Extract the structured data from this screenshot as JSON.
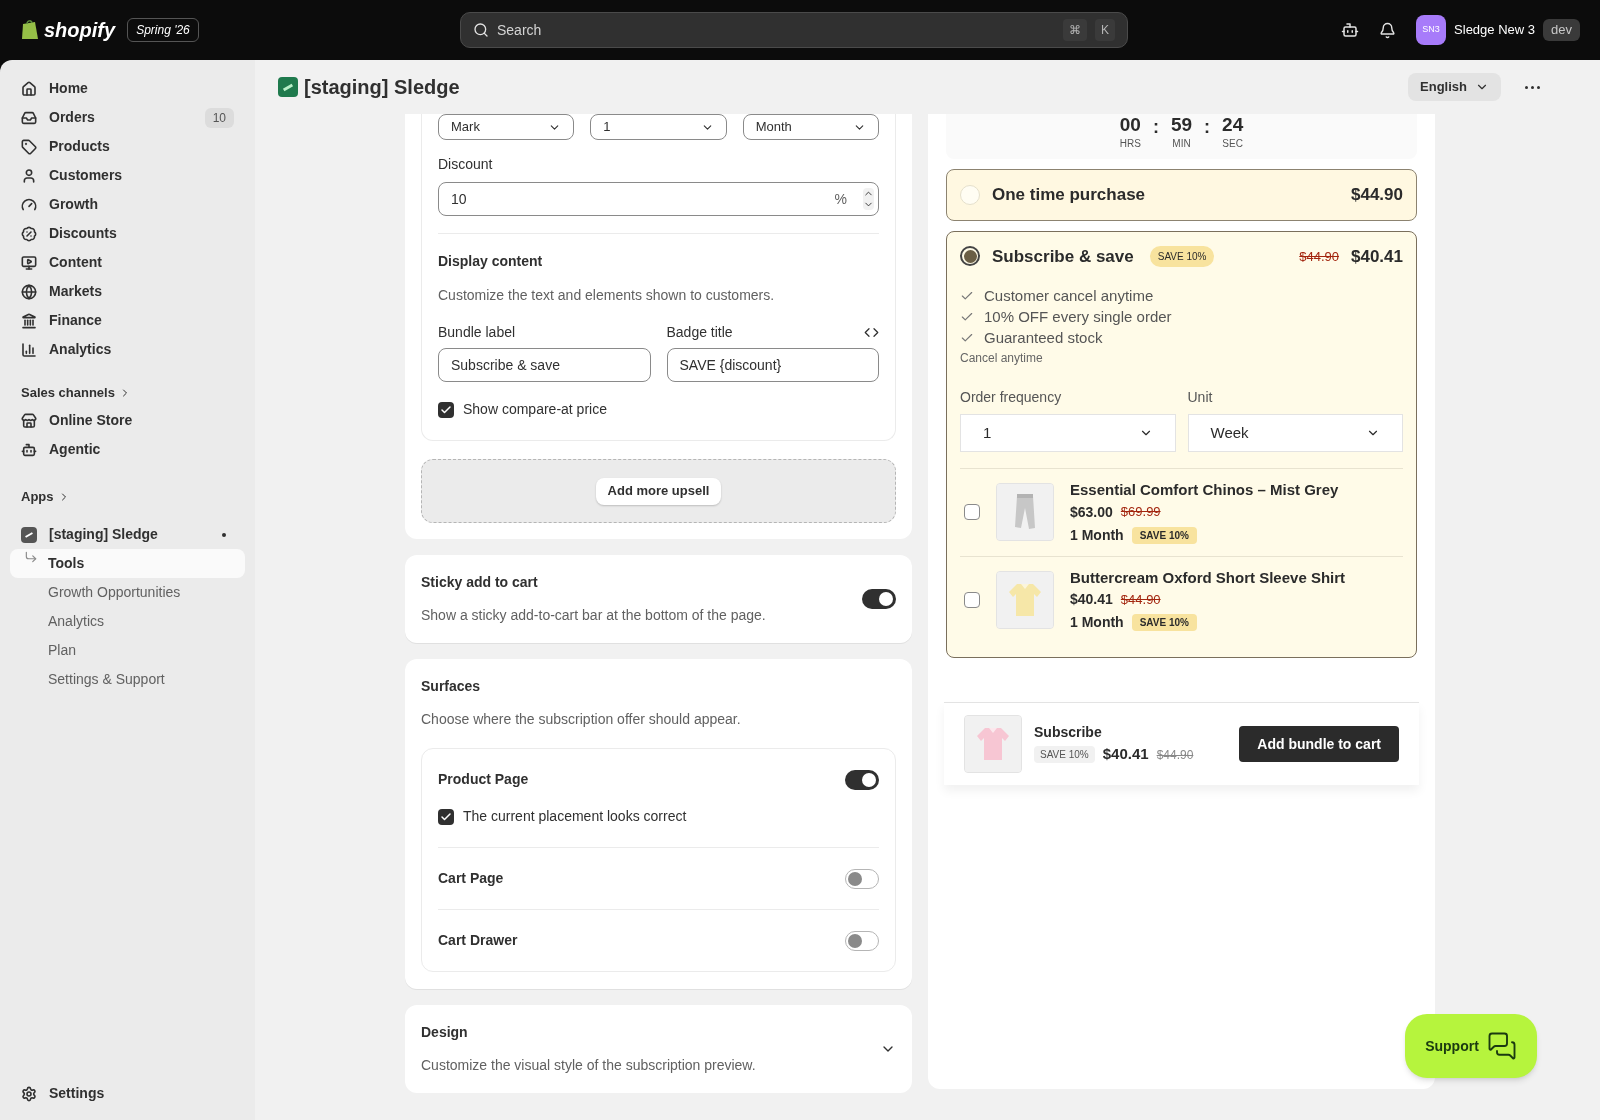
{
  "topbar": {
    "logo": "shopify",
    "edition": "Spring '26",
    "search": {
      "placeholder": "Search"
    },
    "shortcut": [
      "⌘",
      "K"
    ],
    "account": {
      "initials": "SN3",
      "name": "Sledge New 3",
      "env": "dev"
    }
  },
  "sidebar": {
    "items": [
      {
        "label": "Home"
      },
      {
        "label": "Orders",
        "badge": "10"
      },
      {
        "label": "Products"
      },
      {
        "label": "Customers"
      },
      {
        "label": "Growth"
      },
      {
        "label": "Discounts"
      },
      {
        "label": "Content"
      },
      {
        "label": "Markets"
      },
      {
        "label": "Finance"
      },
      {
        "label": "Analytics"
      }
    ],
    "sales_channels": {
      "heading": "Sales channels",
      "items": [
        {
          "label": "Online Store"
        },
        {
          "label": "Agentic"
        }
      ]
    },
    "apps": {
      "heading": "Apps",
      "app": "[staging] Sledge",
      "subitems": [
        {
          "label": "Tools",
          "selected": true
        },
        {
          "label": "Growth Opportunities",
          "selected": false
        },
        {
          "label": "Analytics",
          "selected": false
        },
        {
          "label": "Plan",
          "selected": false
        },
        {
          "label": "Settings & Support",
          "selected": false
        }
      ]
    },
    "settings": "Settings"
  },
  "page": {
    "title": "[staging] Sledge",
    "language": "English"
  },
  "editor": {
    "selects": [
      "Mark",
      "1",
      "Month"
    ],
    "discount": {
      "label": "Discount",
      "value": "10",
      "suffix": "%"
    },
    "display": {
      "title": "Display content",
      "description": "Customize the text and elements shown to customers.",
      "bundle_label": {
        "label": "Bundle label",
        "value": "Subscribe & save"
      },
      "badge_title": {
        "label": "Badge title",
        "value": "SAVE {discount}"
      },
      "compare": {
        "label": "Show compare-at price",
        "checked": true
      }
    },
    "add_upsell": "Add more upsell",
    "sticky": {
      "title": "Sticky add to cart",
      "description": "Show a sticky add-to-cart bar at the bottom of the page.",
      "on": true
    },
    "surfaces": {
      "title": "Surfaces",
      "description": "Choose where the subscription offer should appear.",
      "items": [
        {
          "label": "Product Page",
          "on": true,
          "confirm": {
            "label": "The current placement looks correct",
            "checked": true
          }
        },
        {
          "label": "Cart Page",
          "on": false
        },
        {
          "label": "Cart Drawer",
          "on": false
        }
      ]
    },
    "design": {
      "title": "Design",
      "description": "Customize the visual style of the subscription preview."
    }
  },
  "preview": {
    "timer": [
      {
        "value": "00",
        "unit": "HRS"
      },
      {
        "value": "59",
        "unit": "MIN"
      },
      {
        "value": "24",
        "unit": "SEC"
      }
    ],
    "separator": ":",
    "options": [
      {
        "label": "One time purchase",
        "price": "$44.90",
        "selected": false
      },
      {
        "label": "Subscribe & save",
        "badge": "SAVE 10%",
        "compare": "$44.90",
        "price": "$40.41",
        "selected": true,
        "benefits": [
          "Customer cancel anytime",
          "10% OFF every single order",
          "Guaranteed stock"
        ],
        "note": "Cancel anytime",
        "frequency": {
          "label": "Order frequency",
          "value": "1"
        },
        "unit": {
          "label": "Unit",
          "value": "Week"
        },
        "upsells": [
          {
            "name": "Essential Comfort Chinos – Mist Grey",
            "price": "$63.00",
            "compare": "$69.99",
            "interval": "1 Month",
            "badge": "SAVE 10%",
            "checked": false
          },
          {
            "name": "Buttercream Oxford Short Sleeve Shirt",
            "price": "$40.41",
            "compare": "$44.90",
            "interval": "1 Month",
            "badge": "SAVE 10%",
            "checked": false
          }
        ]
      }
    ],
    "sticky_bar": {
      "title": "Subscribe",
      "badge": "SAVE 10%",
      "price": "$40.41",
      "compare": "$44.90",
      "button": "Add bundle to cart"
    }
  },
  "support": "Support"
}
